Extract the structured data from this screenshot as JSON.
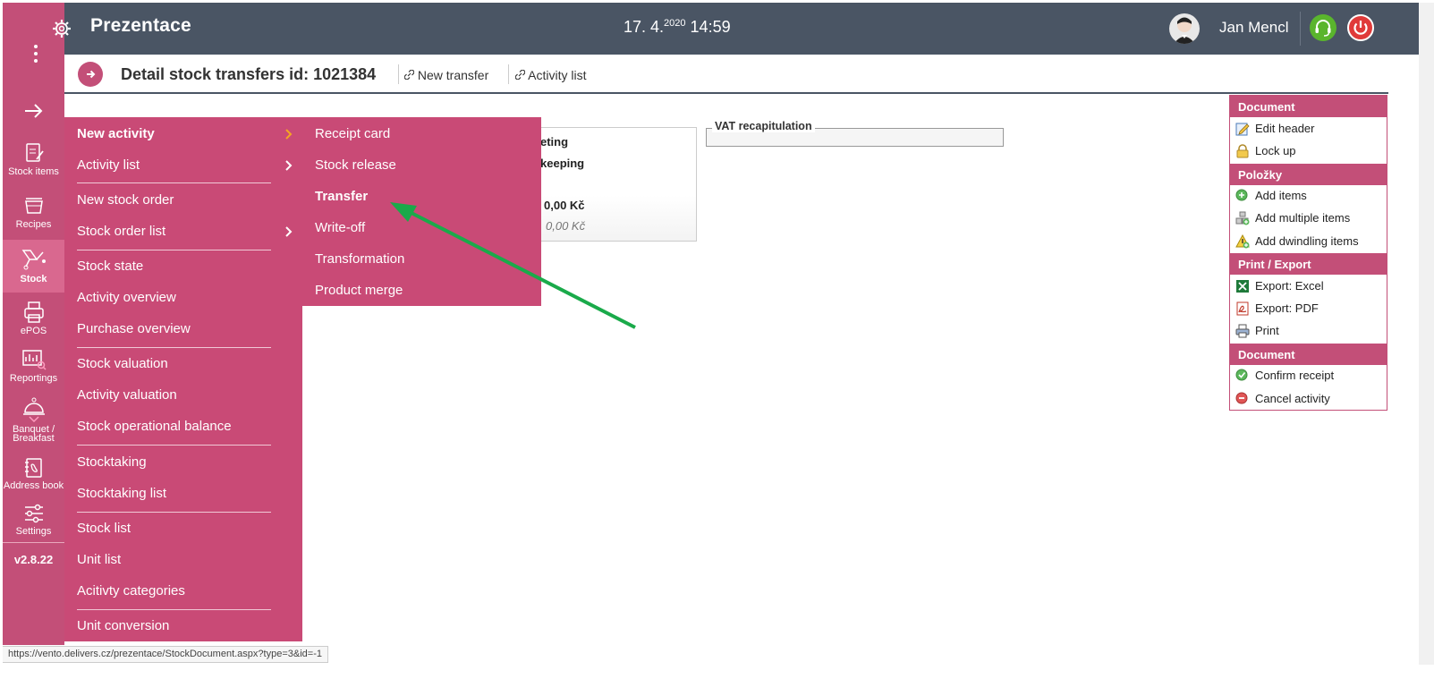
{
  "header": {
    "app_title": "Prezentace",
    "date": "17. 4.",
    "year": "2020",
    "time": "14:59",
    "user_name": "Jan Mencl"
  },
  "sidebar": {
    "items": [
      {
        "label": "Stock items",
        "icon": "stock-items-icon"
      },
      {
        "label": "Recipes",
        "icon": "recipes-icon"
      },
      {
        "label": "Stock",
        "icon": "stock-icon"
      },
      {
        "label": "ePOS",
        "icon": "epos-icon"
      },
      {
        "label": "Reportings",
        "icon": "reportings-icon"
      },
      {
        "label": "Banquet / Breakfast",
        "icon": "banquet-icon"
      },
      {
        "label": "Address book",
        "icon": "address-book-icon"
      },
      {
        "label": "Settings",
        "icon": "settings-icon"
      }
    ],
    "version": "v2.8.22"
  },
  "breadcrumb": {
    "title": "Detail stock transfers id: 1021384",
    "links": [
      "New transfer",
      "Activity list"
    ]
  },
  "card": {
    "line1": "eting",
    "line2": "keeping",
    "amount": "0,00 Kč",
    "amount_italic": "0,00 Kč"
  },
  "vat": {
    "legend": "VAT recapitulation"
  },
  "menu": {
    "items": [
      "New activity",
      "Activity list",
      "New stock order",
      "Stock order list",
      "Stock state",
      "Activity overview",
      "Purchase overview",
      "Stock valuation",
      "Activity valuation",
      "Stock operational balance",
      "Stocktaking",
      "Stocktaking list",
      "Stock list",
      "Unit list",
      "Acitivty categories",
      "Unit conversion"
    ],
    "submenu": [
      "Receipt card",
      "Stock release",
      "Transfer",
      "Write-off",
      "Transformation",
      "Product merge"
    ]
  },
  "right_panel": {
    "sections": [
      {
        "title": "Document",
        "items": [
          "Edit header",
          "Lock up"
        ]
      },
      {
        "title": "Položky",
        "items": [
          "Add items",
          "Add multiple items",
          "Add dwindling items"
        ]
      },
      {
        "title": "Print / Export",
        "items": [
          "Export: Excel",
          "Export: PDF",
          "Print"
        ]
      },
      {
        "title": "Document",
        "items": [
          "Confirm receipt",
          "Cancel activity"
        ]
      }
    ]
  },
  "status_url": "https://vento.delivers.cz/prezentace/StockDocument.aspx?type=3&id=-1",
  "colors": {
    "brand": "#c94a76",
    "header": "#4a5564",
    "arrow": "#1aaa4a"
  }
}
